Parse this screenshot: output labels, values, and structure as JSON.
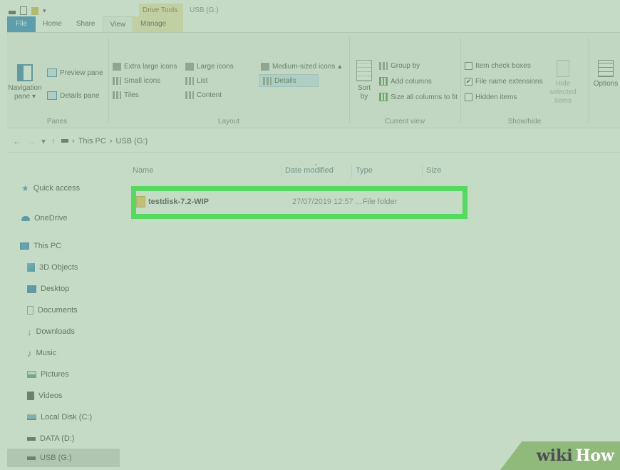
{
  "title_bar": {
    "context_tab_label": "Drive Tools",
    "window_title": "USB (G:)"
  },
  "tabs": [
    {
      "label": "File"
    },
    {
      "label": "Home"
    },
    {
      "label": "Share"
    },
    {
      "label": "View"
    },
    {
      "label": "Manage"
    }
  ],
  "ribbon": {
    "panes": {
      "navigation_pane": "Navigation pane ▾",
      "preview_pane": "Preview pane",
      "details_pane": "Details pane",
      "label": "Panes"
    },
    "layout": {
      "extra_large_icons": "Extra large icons",
      "large_icons": "Large icons",
      "medium_icons": "Medium-sized icons",
      "small_icons": "Small icons",
      "list": "List",
      "details": "Details",
      "tiles": "Tiles",
      "content": "Content",
      "label": "Layout"
    },
    "current_view": {
      "sort_by": "Sort by",
      "group_by": "Group by",
      "add_columns": "Add columns",
      "size_all_columns": "Size all columns to fit",
      "label": "Current view"
    },
    "show_hide": {
      "item_check_boxes": "Item check boxes",
      "item_check_boxes_checked": false,
      "file_name_extensions": "File name extensions",
      "file_name_extensions_checked": true,
      "hidden_items": "Hidden items",
      "hidden_items_checked": false,
      "hide_selected": "Hide selected items",
      "label": "Show/hide"
    },
    "options": "Options"
  },
  "address_bar": {
    "crumbs": [
      "This PC",
      "USB (G:)"
    ]
  },
  "nav_pane": {
    "items": [
      {
        "label": "Quick access",
        "icon": "star-icon"
      },
      {
        "label": "OneDrive",
        "icon": "cloud-icon"
      },
      {
        "label": "This PC",
        "icon": "computer-icon"
      },
      {
        "label": "3D Objects",
        "icon": "cube-icon"
      },
      {
        "label": "Desktop",
        "icon": "desktop-icon"
      },
      {
        "label": "Documents",
        "icon": "document-icon"
      },
      {
        "label": "Downloads",
        "icon": "download-icon"
      },
      {
        "label": "Music",
        "icon": "music-icon"
      },
      {
        "label": "Pictures",
        "icon": "pictures-icon"
      },
      {
        "label": "Videos",
        "icon": "video-icon"
      },
      {
        "label": "Local Disk (C:)",
        "icon": "disk-icon"
      },
      {
        "label": "DATA (D:)",
        "icon": "drive-icon"
      },
      {
        "label": "USB (G:)",
        "icon": "drive-icon",
        "selected": true
      }
    ]
  },
  "file_list": {
    "columns": [
      "Name",
      "Date modified",
      "Type",
      "Size"
    ],
    "rows": [
      {
        "name": "testdisk-7.2-WIP",
        "date": "27/07/2019 12:57 ...",
        "type": "File folder",
        "size": ""
      }
    ]
  },
  "watermark": {
    "part1": "wiki",
    "part2": "How"
  },
  "colors": {
    "highlight": "#00ff1e",
    "file_tab": "#1979ca",
    "context_tab": "#f4e7b4"
  }
}
